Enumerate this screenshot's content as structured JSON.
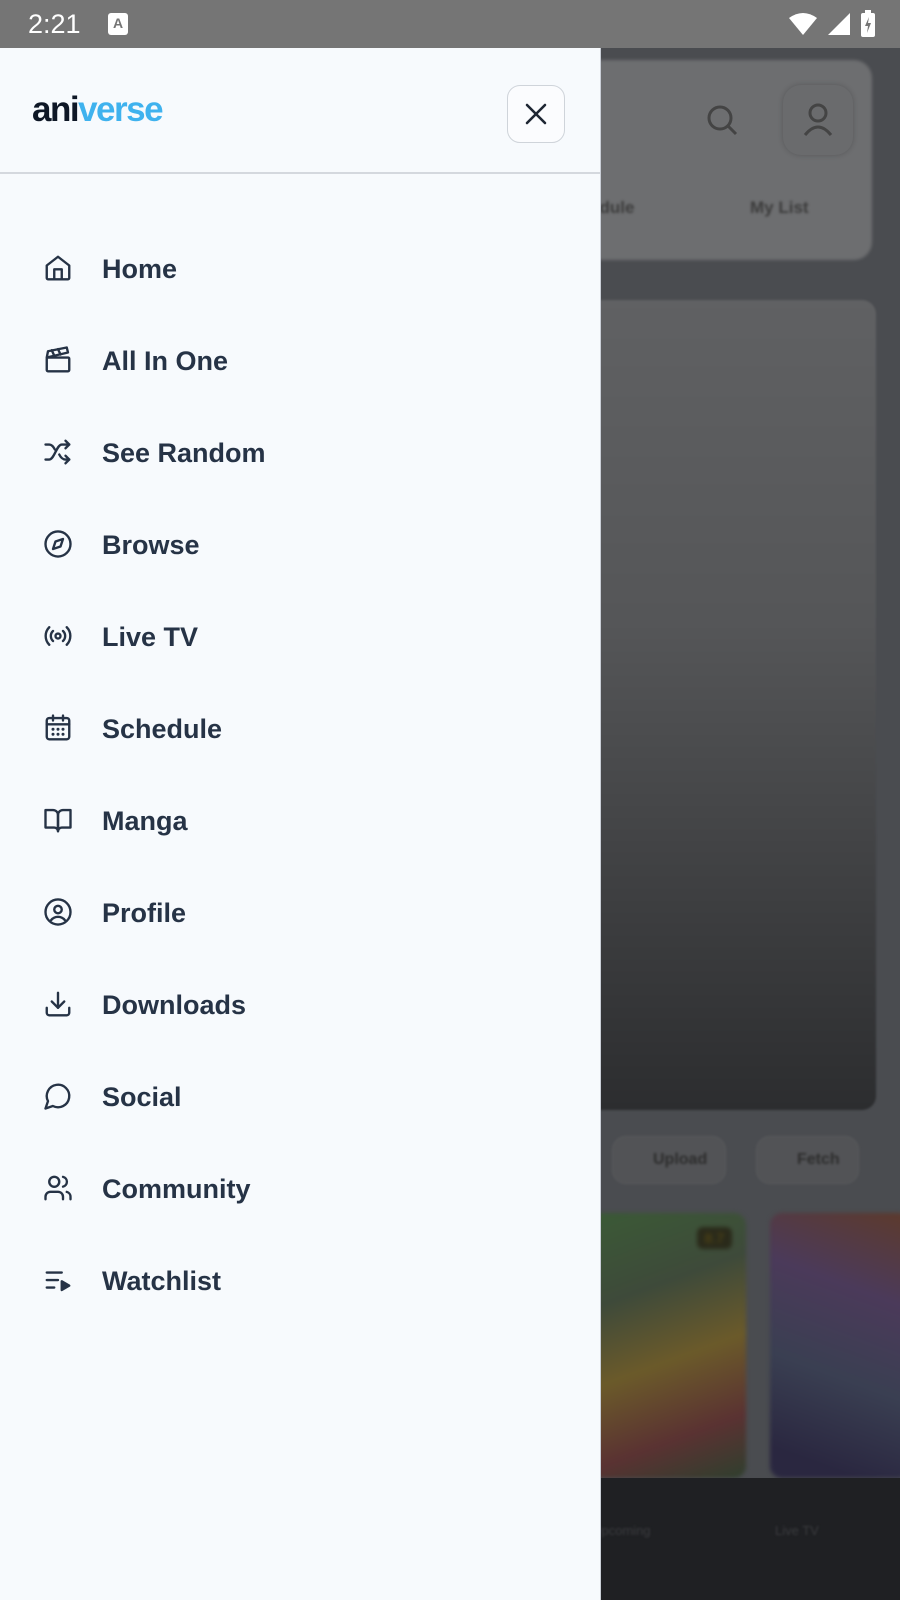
{
  "status_bar": {
    "time": "2:21",
    "notification_icon": "a-keyboard-icon",
    "icons": [
      "wifi-icon",
      "signal-icon",
      "battery-charging-icon"
    ]
  },
  "background_app": {
    "tabs": [
      "edule",
      "My List"
    ],
    "chips": [
      "Upload",
      "Fetch"
    ],
    "badge": "8.7",
    "bottom_nav": [
      "Upcoming",
      "Live TV"
    ]
  },
  "drawer": {
    "logo_part1": "ani",
    "logo_part2": "verse",
    "close_icon": "close-icon",
    "items": [
      {
        "label": "Home",
        "icon": "home-icon"
      },
      {
        "label": "All In One",
        "icon": "clapperboard-icon"
      },
      {
        "label": "See Random",
        "icon": "shuffle-icon"
      },
      {
        "label": "Browse",
        "icon": "compass-icon"
      },
      {
        "label": "Live TV",
        "icon": "radio-broadcast-icon"
      },
      {
        "label": "Schedule",
        "icon": "calendar-icon"
      },
      {
        "label": "Manga",
        "icon": "book-open-icon"
      },
      {
        "label": "Profile",
        "icon": "user-circle-icon"
      },
      {
        "label": "Downloads",
        "icon": "download-icon"
      },
      {
        "label": "Social",
        "icon": "message-circle-icon"
      },
      {
        "label": "Community",
        "icon": "users-icon"
      },
      {
        "label": "Watchlist",
        "icon": "list-video-icon"
      }
    ]
  },
  "colors": {
    "drawer_bg": "#f7fafd",
    "text": "#263346",
    "logo_dark": "#0e1726",
    "logo_accent": "#3fb2ee",
    "status_bar": "#757575"
  }
}
